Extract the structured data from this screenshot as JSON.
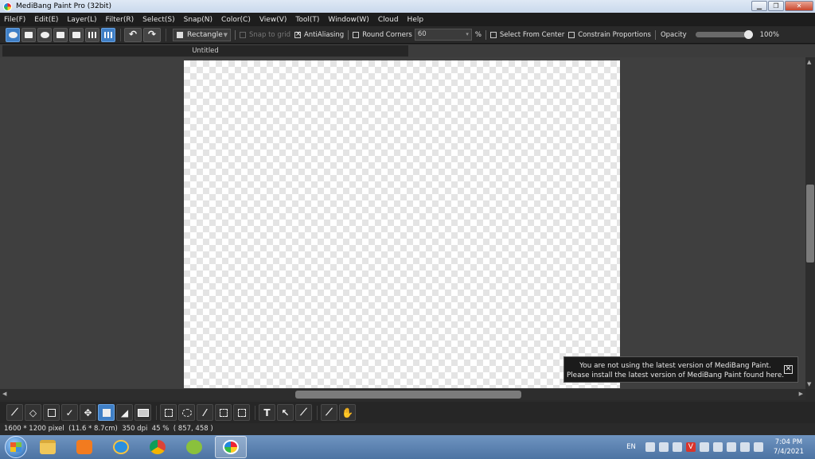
{
  "window": {
    "title": "MediBang Paint Pro (32bit)",
    "buttons": [
      "minimize",
      "restore",
      "close"
    ]
  },
  "menu": [
    "File(F)",
    "Edit(E)",
    "Layer(L)",
    "Filter(R)",
    "Select(S)",
    "Snap(N)",
    "Color(C)",
    "View(V)",
    "Tool(T)",
    "Window(W)",
    "Cloud",
    "Help"
  ],
  "toolbar": {
    "left_icons": [
      "cloud-icon",
      "share-icon",
      "comment-icon",
      "message-icon",
      "page-icon",
      "panel-icon",
      "grid-icon"
    ],
    "undo_glyph": "↶",
    "redo_glyph": "↷",
    "shape": "Rectangle",
    "snap_to_grid": {
      "label": "Snap to grid",
      "checked": false
    },
    "antialiasing": {
      "label": "AntiAliasing",
      "checked": true
    },
    "round_corners": {
      "label": "Round Corners",
      "checked": false,
      "value": "60",
      "unit": "%"
    },
    "select_from_center": {
      "label": "Select From Center",
      "checked": false
    },
    "constrain_proportions": {
      "label": "Constrain Proportions",
      "checked": false
    },
    "opacity": {
      "label": "Opacity",
      "value": 1.0,
      "display": "100%"
    }
  },
  "document": {
    "tab_title": "Untitled"
  },
  "notification": {
    "line1": "You are not using the latest version of MediBang Paint.",
    "line2": "Please install the latest version of MediBang Paint found here.",
    "close_glyph": "✕"
  },
  "tools": [
    "brush",
    "eraser",
    "dot",
    "bucket-brush",
    "move",
    "shape",
    "fill",
    "gradient",
    "select",
    "lasso",
    "magic-wand",
    "select-pen",
    "select-eraser",
    "text",
    "operation",
    "divide",
    "eyedropper",
    "hand"
  ],
  "status_bar": {
    "size": "1600 * 1200 pixel",
    "physical": "(11.6 * 8.7cm)",
    "dpi": "350 dpi",
    "zoom": "45 %",
    "cursor": "( 857, 458 )"
  },
  "taskbar": {
    "apps": [
      "explorer",
      "media-player",
      "internet-explorer",
      "chrome",
      "app-green",
      "medibang-paint"
    ],
    "language": "EN",
    "time": "7:04 PM",
    "date": "7/4/2021"
  }
}
